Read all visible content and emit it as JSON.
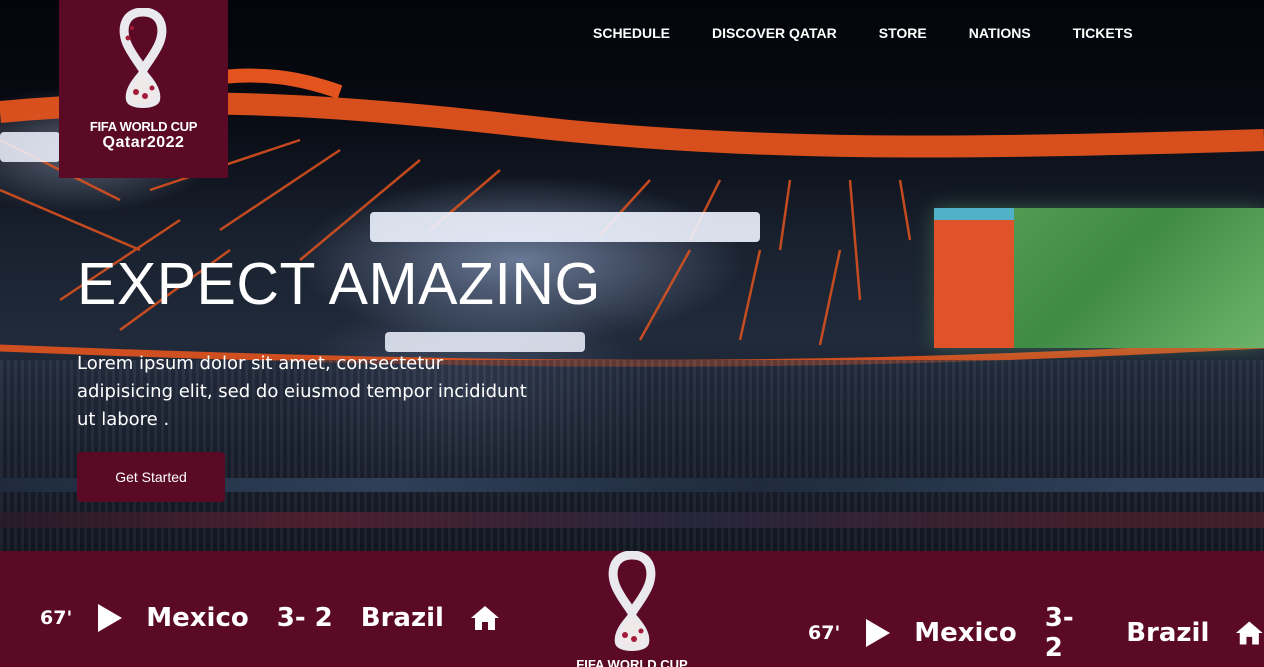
{
  "logo": {
    "line1": "FIFA WORLD CUP",
    "line2": "Qatar2022"
  },
  "nav": {
    "items": [
      {
        "label": "SCHEDULE"
      },
      {
        "label": "DISCOVER QATAR"
      },
      {
        "label": "STORE"
      },
      {
        "label": "NATIONS"
      },
      {
        "label": "TICKETS"
      }
    ]
  },
  "hero": {
    "title": "EXPECT AMAZING",
    "text": "Lorem ipsum dolor sit amet, consectetur adipisicing elit, sed do eiusmod tempor incididunt ut labore .",
    "cta_label": "Get Started"
  },
  "bottom_bar": {
    "logo_text": "FIFA WORLD CUP",
    "matches": [
      {
        "minute": "67'",
        "home": "Mexico",
        "score": "3- 2",
        "away": "Brazil"
      },
      {
        "minute": "67'",
        "home": "Mexico",
        "score": "3- 2",
        "away": "Brazil"
      }
    ]
  },
  "colors": {
    "brand": "#5a0a24",
    "accent_roof": "#e2531e",
    "text": "#ffffff"
  },
  "icons": [
    "play-icon",
    "home-icon",
    "world-cup-emblem-icon"
  ]
}
